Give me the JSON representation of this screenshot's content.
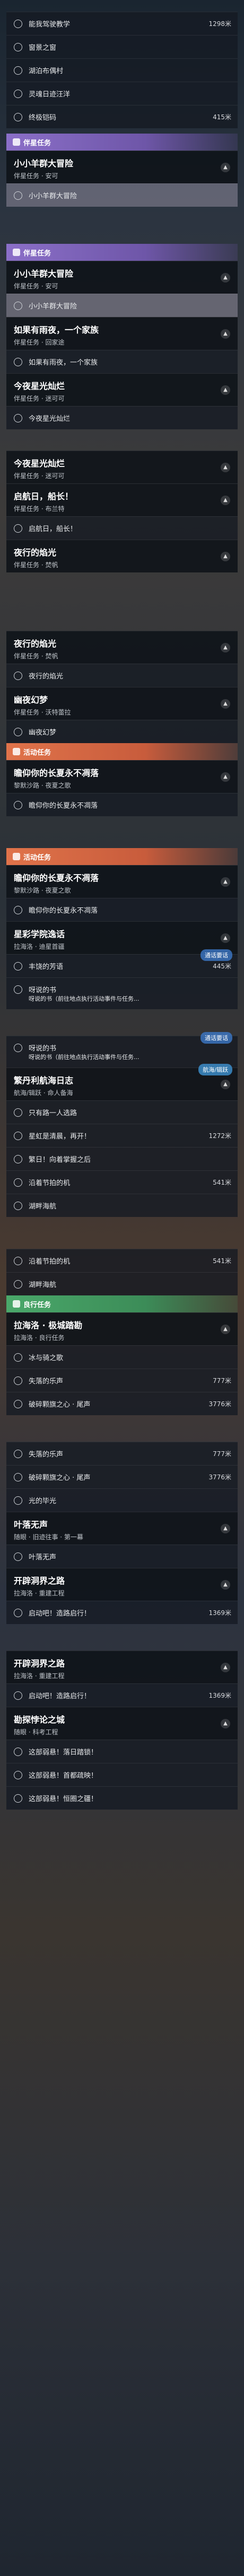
{
  "top_rows": [
    {
      "label": "能我驾驶教学",
      "dist": "1298米"
    },
    {
      "label": "窗景之窗",
      "dist": ""
    },
    {
      "label": "湖泊布偶村",
      "dist": ""
    },
    {
      "label": "灵魂日迹汪洋",
      "dist": ""
    },
    {
      "label": "终极铠码",
      "dist": "415米"
    }
  ],
  "cat_companion": "伴星任务",
  "m1": {
    "title": "小小羊群大冒险",
    "sub": "伴星任务 · 安可"
  },
  "m1_row": "小小羊群大冒险",
  "m2": {
    "title": "如果有雨夜，一个家族",
    "sub": "伴星任务 · 回家途"
  },
  "m2_row": "如果有雨夜，一个家族",
  "m3": {
    "title": "今夜星光灿烂",
    "sub": "伴星任务 · 迷可可"
  },
  "m3_row": "今夜星光灿烂",
  "m4": {
    "title": "启航日，船长！",
    "sub": "伴星任务 · 布兰特"
  },
  "m4_row": "启航日，船长！",
  "m5": {
    "title": "夜行的焰光",
    "sub": "伴星任务 · 焚帆"
  },
  "m5_row": "夜行的焰光",
  "m6": {
    "title": "幽夜幻梦",
    "sub": "伴星任务 · 沃特蕾拉"
  },
  "m6_row": "幽夜幻梦",
  "cat_activity": "活动任务",
  "m7": {
    "title": "瞻仰你的长夏永不凋落",
    "sub": "黎默沙路 · 夜夏之歌"
  },
  "m7_row": "瞻仰你的长夏永不凋落",
  "m8": {
    "title": "星彩学院逸话",
    "sub": "拉海洛 · 迪星首疆"
  },
  "m8_rows": [
    {
      "label": "丰饶的芳语",
      "dist": "445米"
    },
    {
      "label": "呀说的书",
      "dist": ""
    }
  ],
  "m8_warn": "呀说的书（前往地点执行活动事件与任务...",
  "badge_chat": "通话要话",
  "badge_fly": "航海/辑跃",
  "m9": {
    "title": "繁丹利航海日志",
    "sub": "航海/辑跃 · 命人备海"
  },
  "m9_rows": [
    {
      "label": "只有路一人选路",
      "dist": ""
    },
    {
      "label": "星虹是清晨，再开！",
      "dist": "1272米"
    },
    {
      "label": "繁日！向着掌握之后",
      "dist": ""
    },
    {
      "label": "沿着节拍的机",
      "dist": "541米"
    },
    {
      "label": "湖畔海航",
      "dist": ""
    }
  ],
  "cat_daily": "良行任务",
  "m10": {
    "title": "拉海洛 · 极城踏勘",
    "sub": "拉海洛 · 良行任务"
  },
  "m10_rows": [
    {
      "label": "冰与骑之歌",
      "dist": ""
    },
    {
      "label": "失落的乐声",
      "dist": "777米"
    },
    {
      "label": "破碎颗旗之心 · 尾声",
      "dist": "3776米"
    },
    {
      "label": "光的毕光",
      "dist": ""
    }
  ],
  "m11": {
    "title": "叶落无声",
    "sub": "随眼 · 旧迹往事 · 第一幕"
  },
  "m11_row": "叶落无声",
  "m12": {
    "title": "开辟洞界之路",
    "sub": "拉海洛 · 重建工程"
  },
  "m12_row": {
    "label": "启动吧！造路启行！",
    "dist": "1369米"
  },
  "m13": {
    "title": "勘探悖论之城",
    "sub": "随眼 · 科考工程"
  },
  "m13_rows": [
    {
      "label": "这部弱悬！落日踏锁！",
      "dist": ""
    },
    {
      "label": "这部弱悬！首都疏映！",
      "dist": ""
    },
    {
      "label": "这部弱悬！恒圈之疆！",
      "dist": ""
    }
  ]
}
